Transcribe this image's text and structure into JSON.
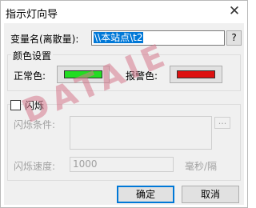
{
  "window": {
    "title": "指示灯向导",
    "close_glyph": "✕"
  },
  "variable": {
    "label": "变量名(离散量):",
    "value": "\\\\本站点\\t2",
    "browse_label": "?"
  },
  "color_group": {
    "caption": "颜色设置",
    "normal_label": "正常色:",
    "normal_color": "#22dd22",
    "alarm_label": "报警色:",
    "alarm_color": "#dd1111"
  },
  "blink": {
    "checkbox_label": "闪烁",
    "checked": false,
    "condition_label": "闪烁条件:",
    "condition_browse_label": "...",
    "speed_label": "闪烁速度:",
    "speed_value": "1000",
    "speed_unit": "毫秒/隔"
  },
  "buttons": {
    "ok": "确定",
    "cancel": "取消"
  },
  "watermark": "DATAIE",
  "colors": {
    "accent": "#0078d7",
    "client_bg": "#f0f0f0",
    "disabled_text": "#a0a0a0"
  }
}
